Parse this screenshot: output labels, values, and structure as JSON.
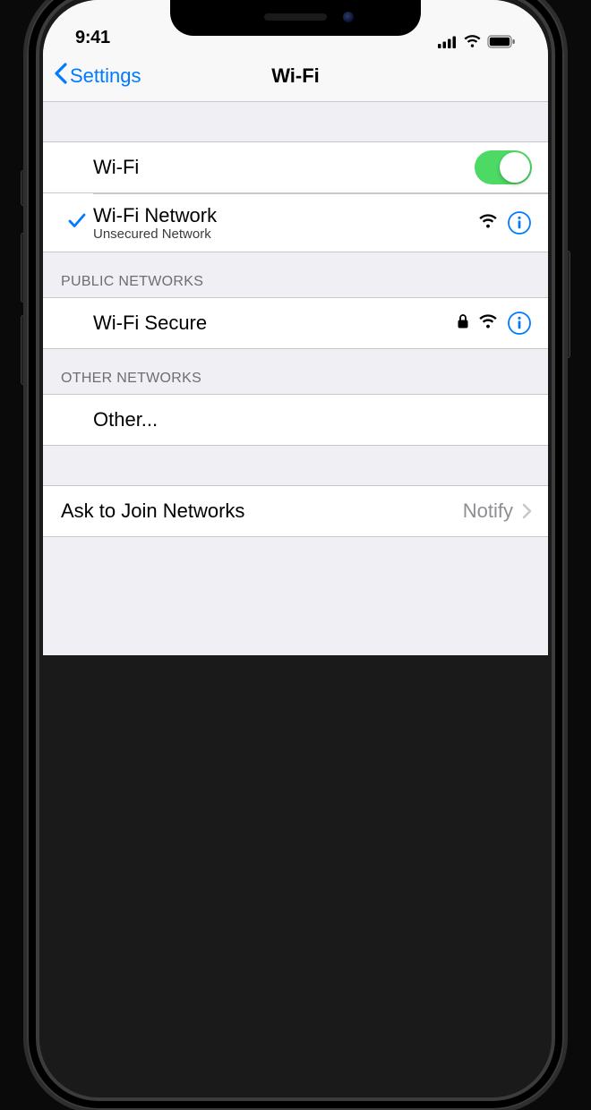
{
  "status": {
    "time": "9:41"
  },
  "nav": {
    "back_label": "Settings",
    "title": "Wi-Fi"
  },
  "wifi_toggle": {
    "label": "Wi-Fi",
    "on": true
  },
  "connected_network": {
    "name": "Wi-Fi Network",
    "subtitle": "Unsecured Network"
  },
  "sections": {
    "public_header": "PUBLIC NETWORKS",
    "other_header": "OTHER NETWORKS"
  },
  "public_networks": [
    {
      "name": "Wi-Fi Secure",
      "locked": true
    }
  ],
  "other_row": {
    "label": "Other..."
  },
  "ask_to_join": {
    "label": "Ask to Join Networks",
    "value": "Notify"
  },
  "colors": {
    "tint": "#007aff",
    "switch_on": "#4cd964"
  }
}
